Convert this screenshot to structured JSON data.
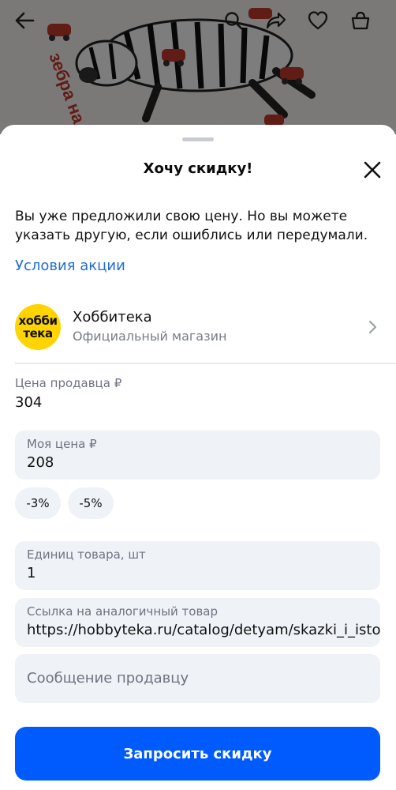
{
  "background": {
    "artwork_text": "зебра на",
    "icons": [
      "back-arrow-icon",
      "search-icon",
      "share-icon",
      "heart-icon",
      "basket-icon"
    ]
  },
  "sheet": {
    "title": "Хочу скидку!",
    "description": "Вы уже предложили свою цену. Но вы можете указать другую, если ошиблись или передумали.",
    "terms_link": "Условия акции"
  },
  "seller": {
    "name": "Хоббитека",
    "subtitle": "Официальный магазин",
    "logo_line1": "хобби",
    "logo_line2": "тека",
    "logo_color": "#ffd400"
  },
  "seller_price": {
    "label": "Цена продавца ₽",
    "value": "304"
  },
  "my_price": {
    "label": "Моя цена ₽",
    "value": "208"
  },
  "discount_chips": [
    "-3%",
    "-5%"
  ],
  "quantity": {
    "label": "Единиц товара, шт",
    "value": "1"
  },
  "similar_link": {
    "label": "Ссылка на аналогичный товар",
    "value": "https://hobbyteka.ru/catalog/detyam/skazki_i_isto"
  },
  "message": {
    "placeholder": "Сообщение продавцу"
  },
  "submit_label": "Запросить скидку",
  "colors": {
    "accent": "#005bff",
    "link": "#1f6ed4",
    "field_bg": "#eff2f6"
  }
}
